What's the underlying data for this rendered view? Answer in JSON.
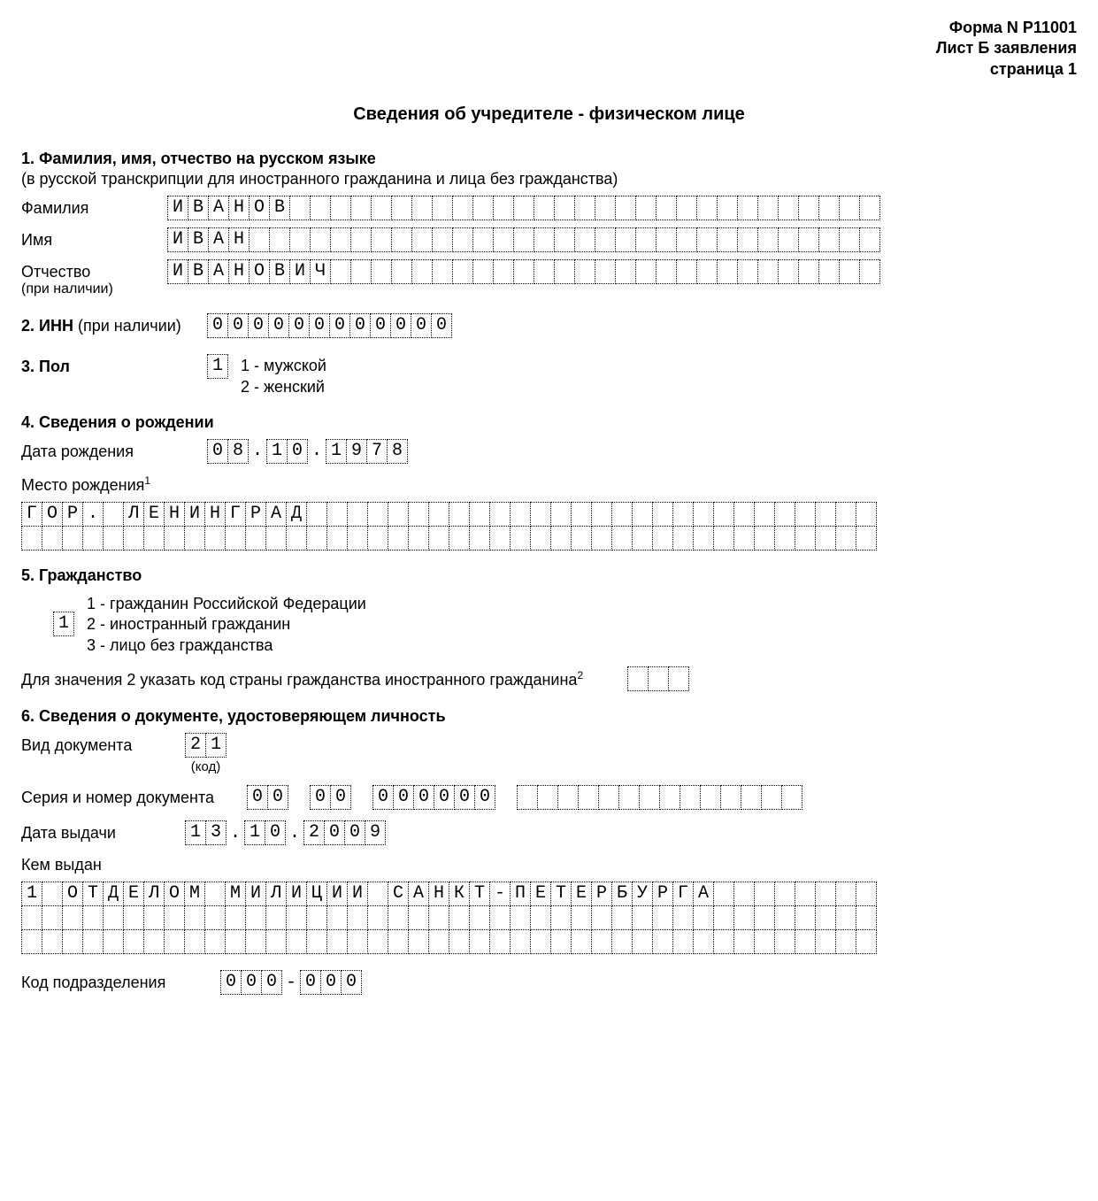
{
  "header": {
    "form_number": "Форма N Р11001",
    "sheet": "Лист Б заявления",
    "page": "страница 1"
  },
  "title": "Сведения об учредителе - физическом лице",
  "s1": {
    "heading": "1. Фамилия, имя, отчество на русском языке",
    "note": "(в русской транскрипции для иностранного гражданина и лица без гражданства)",
    "lastname_label": "Фамилия",
    "lastname_value": "ИВАНОВ",
    "firstname_label": "Имя",
    "firstname_value": "ИВАН",
    "patronymic_label": "Отчество",
    "patronymic_sub": "(при наличии)",
    "patronymic_value": "ИВАНОВИЧ"
  },
  "s2": {
    "heading": "2. ИНН",
    "note": "(при наличии)",
    "value": "000000000000"
  },
  "s3": {
    "heading": "3. Пол",
    "value": "1",
    "opt1": "1 - мужской",
    "opt2": "2 - женский"
  },
  "s4": {
    "heading": "4. Сведения о рождении",
    "date_label": "Дата рождения",
    "date_day": "08",
    "date_month": "10",
    "date_year": "1978",
    "place_label": "Место рождения",
    "place_sup": "1",
    "place_line1": "ГОР. ЛЕНИНГРАД",
    "place_line2": ""
  },
  "s5": {
    "heading": "5. Гражданство",
    "value": "1",
    "opt1": "1 - гражданин Российской Федерации",
    "opt2": "2 - иностранный гражданин",
    "opt3": "3 - лицо без гражданства",
    "country_note": "Для значения 2 указать код страны гражданства иностранного гражданина",
    "country_sup": "2",
    "country_value": ""
  },
  "s6": {
    "heading": "6. Сведения о документе, удостоверяющем личность",
    "doctype_label": "Вид документа",
    "doctype_value": "21",
    "doctype_code_note": "(код)",
    "series_label": "Серия и номер документа",
    "series_g1": "00",
    "series_g2": "00",
    "series_g3": "000000",
    "series_blank_count": 14,
    "issue_date_label": "Дата выдачи",
    "issue_day": "13",
    "issue_month": "10",
    "issue_year": "2009",
    "issuer_label": "Кем выдан",
    "issuer_line1": "1 ОТДЕЛОМ МИЛИЦИИ САНКТ-ПЕТЕРБУРГА",
    "issuer_line2": "",
    "issuer_line3": "",
    "dept_label": "Код подразделения",
    "dept_g1": "000",
    "dept_g2": "000"
  },
  "full_row_cells": 42,
  "name_row_cells": 35
}
